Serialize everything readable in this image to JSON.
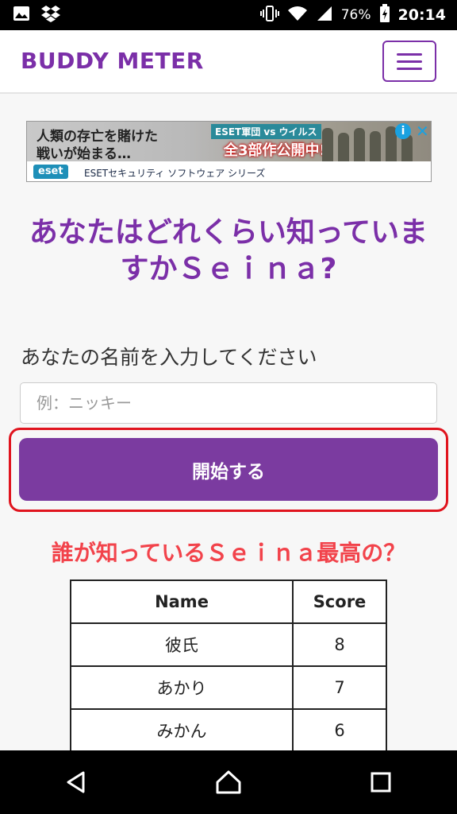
{
  "status_bar": {
    "battery": "76%",
    "time": "20:14",
    "icons": [
      "image-icon",
      "dropbox-icon",
      "vibrate-icon",
      "wifi-icon",
      "signal-icon",
      "battery-icon"
    ]
  },
  "header": {
    "brand": "BUDDY METER",
    "menu_icon": "hamburger-icon"
  },
  "ad": {
    "line1": "人類の存亡を賭けた",
    "line2": "戦いが始まる…",
    "vs_badge": "ESET軍団 vs ウイルス",
    "promo": "全3部作公開中!!",
    "logo": "eset",
    "series": "ESETセキュリティ ソフトウェア シリーズ"
  },
  "main": {
    "title": "あなたはどれくらい知っていますかＳｅｉｎａ?",
    "name_label": "あなたの名前を入力してください",
    "name_placeholder": "例：ニッキー",
    "start_button": "開始する",
    "leaderboard_title": "誰が知っているＳｅｉｎａ最高の？"
  },
  "leaderboard": {
    "headers": {
      "name": "Name",
      "score": "Score"
    },
    "rows": [
      {
        "name": "彼氏",
        "score": "8"
      },
      {
        "name": "あかり",
        "score": "7"
      },
      {
        "name": "みかん",
        "score": "6"
      }
    ]
  },
  "colors": {
    "brand": "#7b2fa8",
    "button": "#7b3ba0",
    "highlight": "#e0141e",
    "subheading": "#f2434b"
  }
}
